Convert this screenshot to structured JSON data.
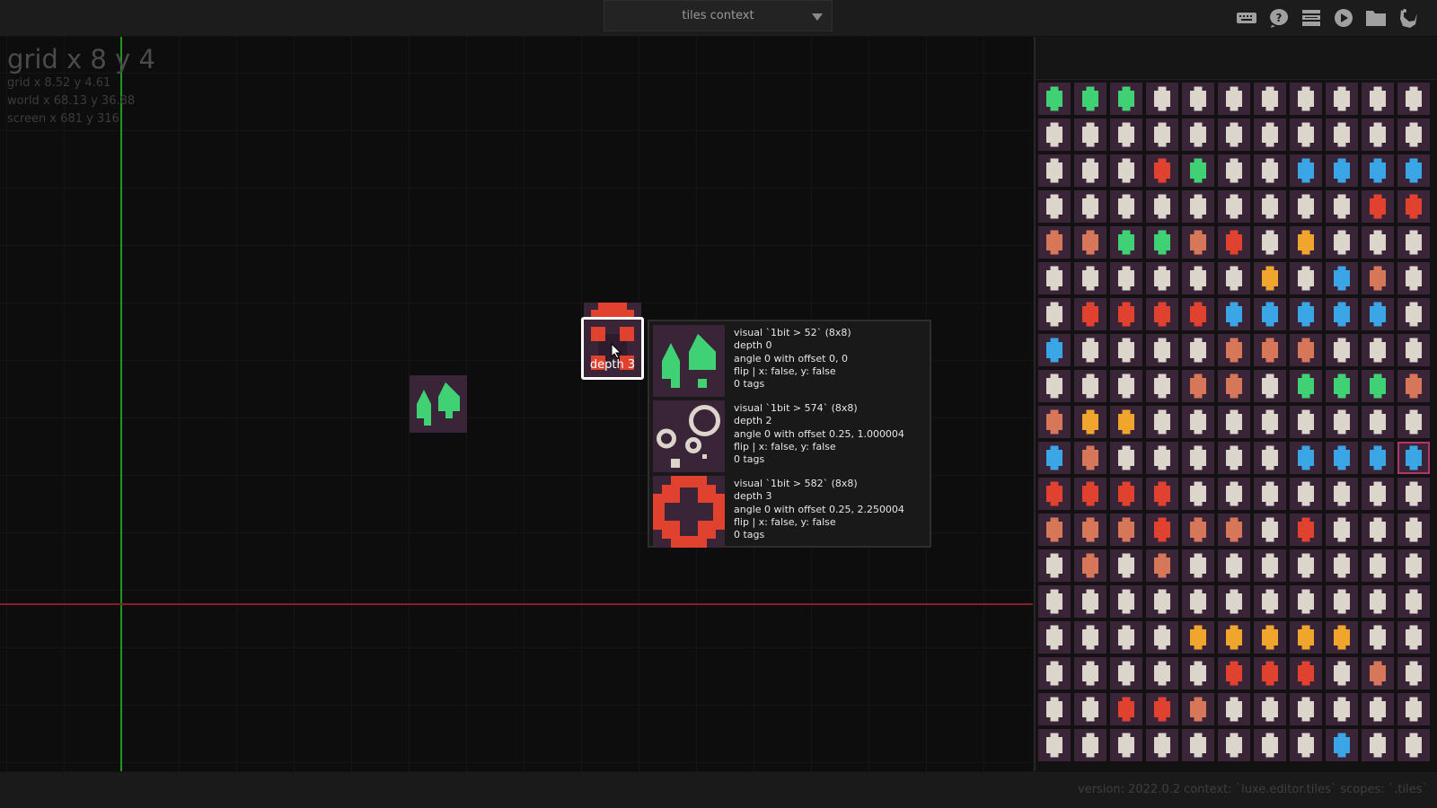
{
  "context_select": {
    "value": "tiles context"
  },
  "toolbar": {
    "icons": [
      "keyboard-icon",
      "help-icon",
      "layers-icon",
      "play-icon",
      "folder-icon",
      "settings-icon"
    ]
  },
  "coords": {
    "grid_big": "grid x 8 y 4",
    "grid": "grid x 8.52 y 4.61",
    "world": "world x 68.13 y 36.88",
    "screen": "screen x 681 y 316"
  },
  "selected_tile": {
    "label": "depth 3"
  },
  "tooltip": {
    "entries": [
      {
        "visual": "visual `1bit > 52` (8x8)",
        "depth": "depth 0",
        "angle": "angle 0 with offset 0, 0",
        "flip": "flip | x: false, y: false",
        "tags": "0 tags"
      },
      {
        "visual": "visual `1bit > 574` (8x8)",
        "depth": "depth 2",
        "angle": "angle 0 with offset 0.25, 1.000004",
        "flip": "flip | x: false, y: false",
        "tags": "0 tags"
      },
      {
        "visual": "visual `1bit > 582` (8x8)",
        "depth": "depth 3",
        "angle": "angle 0 with offset 0.25, 2.250004",
        "flip": "flip | x: false, y: false",
        "tags": "0 tags"
      }
    ]
  },
  "palette": {
    "colors": {
      "bg": "#3a2437",
      "cream": "#dbd5cb",
      "green": "#3fd174",
      "red": "#e0422f",
      "blue": "#3aa6e6",
      "orange": "#f0a52c",
      "salmon": "#d6775a"
    }
  },
  "status": {
    "text": "version: 2022.0.2 context: `luxe.editor.tiles` scopes: `.tiles`"
  }
}
